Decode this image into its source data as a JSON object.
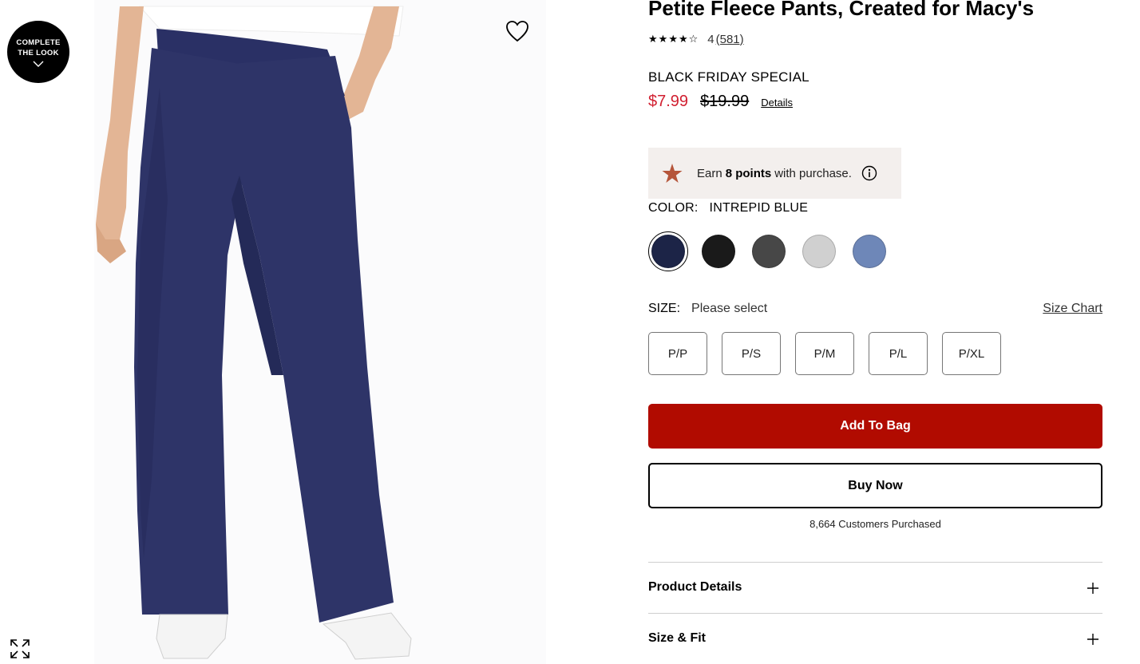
{
  "media": {
    "complete_look_line1": "COMPLETE",
    "complete_look_line2": "THE LOOK",
    "icons": [
      "chevron-down-icon",
      "heart-icon",
      "expand-icon"
    ]
  },
  "product": {
    "title": "Petite Fleece Pants, Created for Macy's",
    "rating": {
      "stars": 4,
      "value": "4",
      "count": "(581)"
    },
    "promo_label": "BLACK FRIDAY SPECIAL",
    "price": {
      "sale": "$7.99",
      "original": "$19.99",
      "details_link": "Details"
    },
    "points": {
      "prefix": "Earn",
      "amount": "8 points",
      "suffix": "with purchase.",
      "star_color": "#b5553a"
    },
    "color": {
      "label": "COLOR:",
      "selected": "INTREPID BLUE",
      "swatches": [
        {
          "hex": "#1c2447",
          "selected": true
        },
        {
          "hex": "#1a1a1a",
          "selected": false
        },
        {
          "hex": "#474747",
          "selected": false
        },
        {
          "hex": "#d0d0d0",
          "selected": false
        },
        {
          "hex": "#6e87b8",
          "selected": false
        }
      ]
    },
    "size": {
      "label": "SIZE:",
      "value": "Please select",
      "chart_link": "Size Chart",
      "options": [
        "P/P",
        "P/S",
        "P/M",
        "P/L",
        "P/XL"
      ]
    },
    "add_to_bag": "Add To Bag",
    "buy_now": "Buy Now",
    "purchased": "8,664 Customers Purchased",
    "accordions": [
      "Product Details",
      "Size & Fit"
    ]
  },
  "colors": {
    "sale_red": "#d12031",
    "bag_button": "#b10b00",
    "points_bg": "#f3efed"
  }
}
